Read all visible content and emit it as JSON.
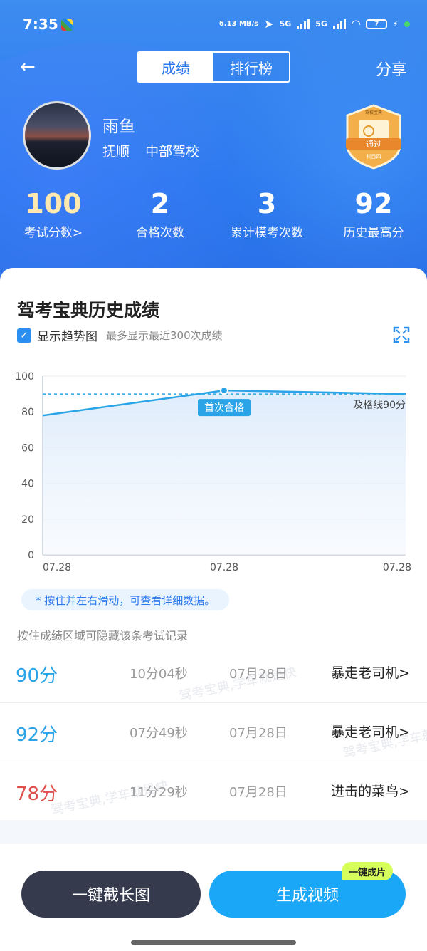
{
  "status_bar": {
    "time": "7:35",
    "net_speed": "6.13 MB/s",
    "net1": "5G",
    "net2": "5G",
    "battery": "7"
  },
  "nav": {
    "tabs": [
      {
        "label": "成绩",
        "active": true
      },
      {
        "label": "排行榜",
        "active": false
      }
    ],
    "share_label": "分享"
  },
  "profile": {
    "name": "雨鱼",
    "city": "抚顺",
    "school": "中部驾校",
    "badge_text": "通过",
    "badge_sub": "科目四",
    "badge_top": "驾校宝典"
  },
  "stats": [
    {
      "value": "100",
      "label": "考试分数>"
    },
    {
      "value": "2",
      "label": "合格次数"
    },
    {
      "value": "3",
      "label": "累计模考次数"
    },
    {
      "value": "92",
      "label": "历史最高分"
    }
  ],
  "history": {
    "title": "驾考宝典历史成绩",
    "trend_label": "显示趋势图",
    "trend_hint": "最多显示最近300次成绩",
    "tip": "* 按住并左右滑动，可查看详细数据。",
    "note": "按住成绩区域可隐藏该条考试记录"
  },
  "chart_data": {
    "type": "area",
    "x": [
      "07.28",
      "07.28",
      "07.28"
    ],
    "values": [
      78,
      92,
      90
    ],
    "ylim": [
      0,
      100
    ],
    "yticks": [
      0,
      20,
      40,
      60,
      80,
      100
    ],
    "pass_line": 90,
    "pass_line_label": "及格线90分",
    "first_pass_label": "首次合格",
    "first_pass_index": 1,
    "grid": true,
    "color": "#2aa4e6"
  },
  "records": [
    {
      "score": "90分",
      "duration": "10分04秒",
      "date": "07月28日",
      "title": "暴走老司机>",
      "passed": true
    },
    {
      "score": "92分",
      "duration": "07分49秒",
      "date": "07月28日",
      "title": "暴走老司机>",
      "passed": true
    },
    {
      "score": "78分",
      "duration": "11分29秒",
      "date": "07月28日",
      "title": "进击的菜鸟>",
      "passed": false
    }
  ],
  "watermark": "驾考宝典,学车就是快",
  "buttons": {
    "screenshot": "一键截长图",
    "video": "生成视频",
    "video_tag": "一键成片"
  }
}
